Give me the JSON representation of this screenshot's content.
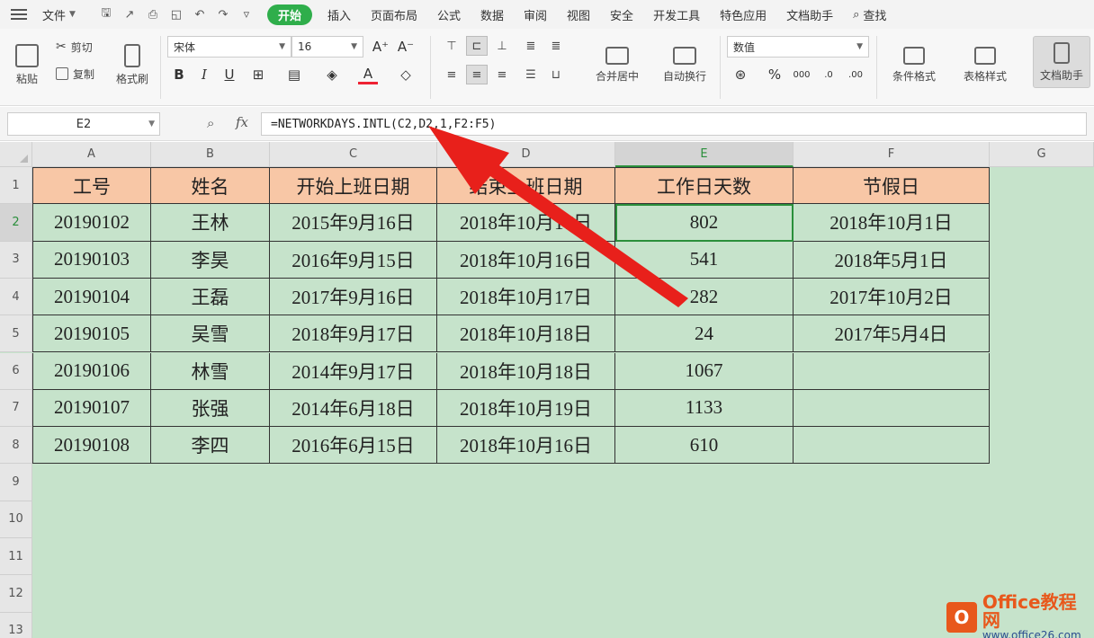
{
  "menu": {
    "file_label": "文件",
    "tabs": [
      "开始",
      "插入",
      "页面布局",
      "公式",
      "数据",
      "审阅",
      "视图",
      "安全",
      "开发工具",
      "特色应用",
      "文档助手"
    ],
    "active_tab": "开始",
    "search_label": "查找",
    "accent": "#2fae4b"
  },
  "ribbon": {
    "paste": "粘贴",
    "cut": "剪切",
    "copy": "复制",
    "format_painter": "格式刷",
    "font_name": "宋体",
    "font_size": "16",
    "grow_font": "A⁺",
    "shrink_font": "A⁻",
    "bold": "B",
    "italic": "I",
    "underline": "U",
    "merge_center": "合并居中",
    "wrap_text": "自动换行",
    "number_format": "数值",
    "percent": "%",
    "conditional_format": "条件格式",
    "table_style": "表格样式",
    "doc_helper": "文档助手"
  },
  "formula_bar": {
    "name_box": "E2",
    "fx": "fx",
    "formula": "=NETWORKDAYS.INTL(C2,D2,1,F2:F5)"
  },
  "sheet": {
    "columns": [
      "A",
      "B",
      "C",
      "D",
      "E",
      "F",
      "G"
    ],
    "rows": [
      "1",
      "2",
      "3",
      "4",
      "5",
      "6",
      "7",
      "8",
      "9",
      "10",
      "11",
      "12",
      "13"
    ],
    "header": [
      "工号",
      "姓名",
      "开始上班日期",
      "结束上班日期",
      "工作日天数",
      "节假日"
    ],
    "data": [
      [
        "20190102",
        "王林",
        "2015年9月16日",
        "2018年10月17日",
        "802",
        "2018年10月1日"
      ],
      [
        "20190103",
        "李昊",
        "2016年9月15日",
        "2018年10月16日",
        "541",
        "2018年5月1日"
      ],
      [
        "20190104",
        "王磊",
        "2017年9月16日",
        "2018年10月17日",
        "282",
        "2017年10月2日"
      ],
      [
        "20190105",
        "吴雪",
        "2018年9月17日",
        "2018年10月18日",
        "24",
        "2017年5月4日"
      ],
      [
        "20190106",
        "林雪",
        "2014年9月17日",
        "2018年10月18日",
        "1067",
        ""
      ],
      [
        "20190107",
        "张强",
        "2014年6月18日",
        "2018年10月19日",
        "1133",
        ""
      ],
      [
        "20190108",
        "李四",
        "2016年6月15日",
        "2018年10月16日",
        "610",
        ""
      ]
    ],
    "selected_cell": "E2",
    "header_fill": "#f8c7a6",
    "body_fill": "#c6e3cb"
  },
  "watermark": {
    "brand": "Office教程网",
    "url": "www.office26.com"
  },
  "annotation": {
    "arrow_color": "#e8201b"
  }
}
